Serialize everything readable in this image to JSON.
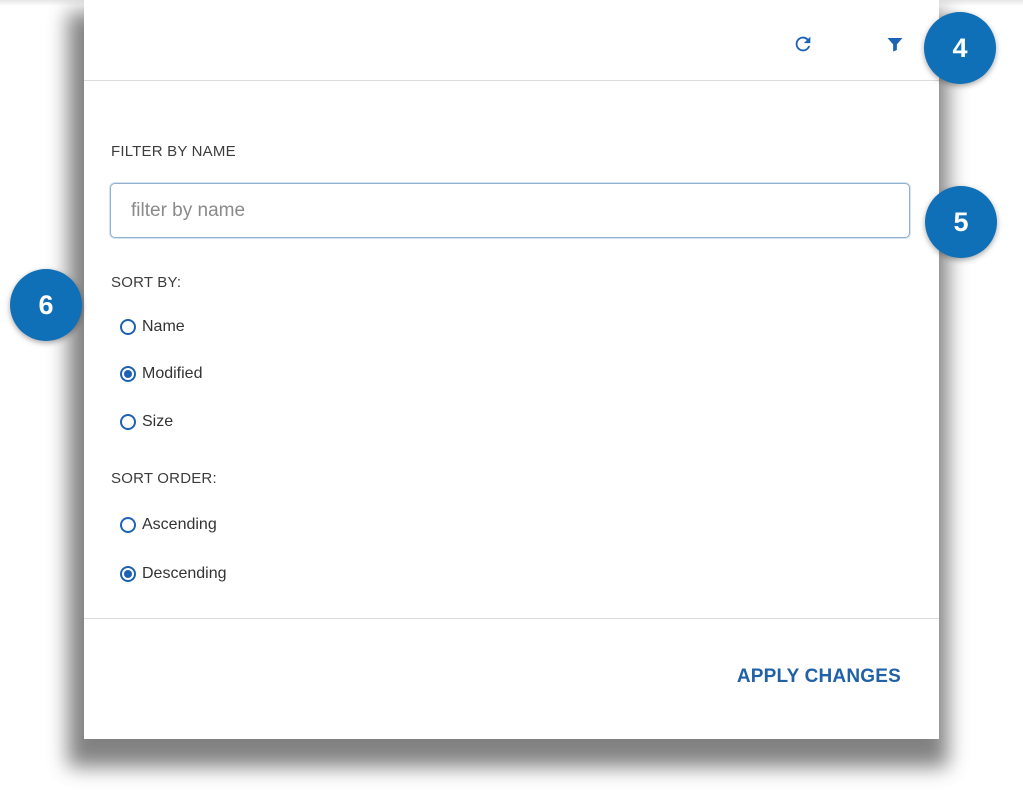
{
  "header": {
    "refresh_icon": "refresh-icon",
    "filter_icon": "filter-icon"
  },
  "filter": {
    "label": "FILTER BY NAME",
    "placeholder": "filter by name",
    "value": ""
  },
  "sort_by": {
    "label": "SORT BY:",
    "options": [
      {
        "label": "Name",
        "checked": false
      },
      {
        "label": "Modified",
        "checked": true
      },
      {
        "label": "Size",
        "checked": false
      }
    ]
  },
  "sort_order": {
    "label": "SORT ORDER:",
    "options": [
      {
        "label": "Ascending",
        "checked": false
      },
      {
        "label": "Descending",
        "checked": true
      }
    ]
  },
  "footer": {
    "apply_label": "APPLY CHANGES"
  },
  "callouts": [
    "4",
    "5",
    "6"
  ],
  "colors": {
    "accent": "#1d63b4",
    "callout": "#0f70b7",
    "apply_text": "#2161a7"
  }
}
